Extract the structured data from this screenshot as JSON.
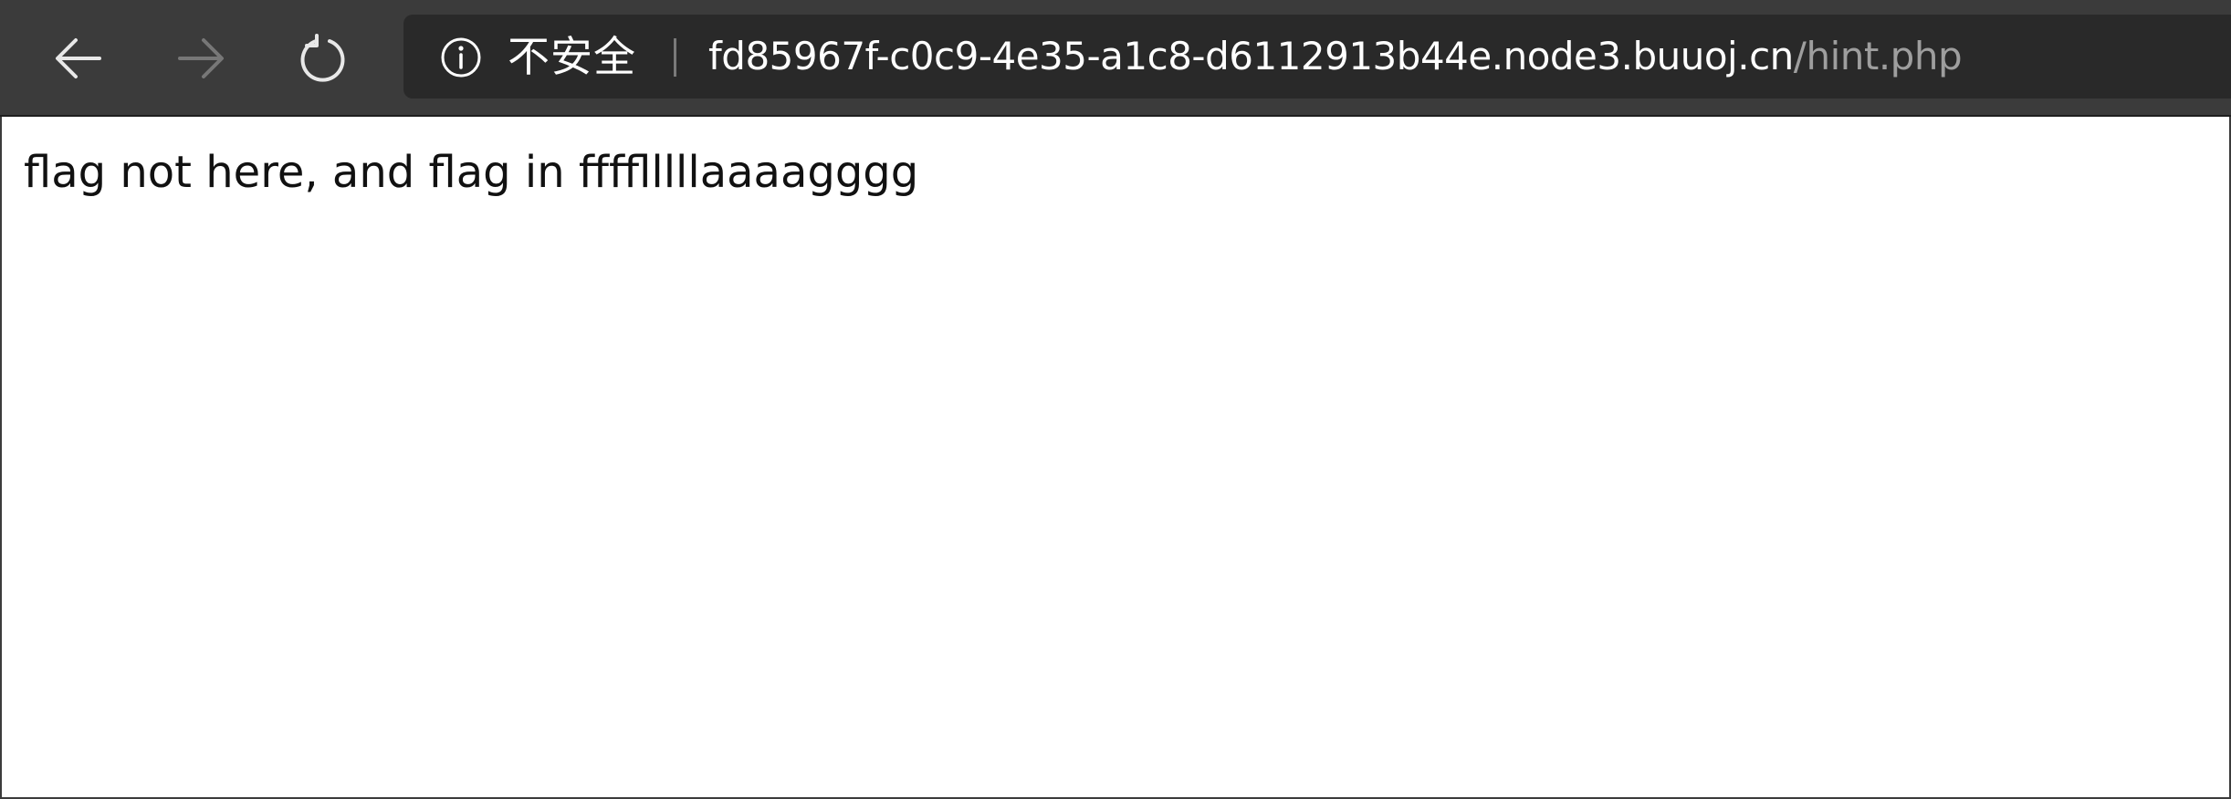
{
  "toolbar": {
    "back_icon": "arrow-left-icon",
    "forward_icon": "arrow-right-icon",
    "reload_icon": "refresh-icon"
  },
  "address_bar": {
    "info_icon": "info-circle-icon",
    "security_label": "不安全",
    "url_host": "fd85967f-c0c9-4e35-a1c8-d6112913b44e.node3.buuoj.cn",
    "url_path": "/hint.php"
  },
  "page": {
    "body_text": "flag not here, and flag in fffflllllaaaagggg"
  },
  "colors": {
    "toolbar_bg": "#3b3b3b",
    "address_bg": "#292929",
    "url_path": "#9e9e9e",
    "page_bg": "#ffffff"
  }
}
